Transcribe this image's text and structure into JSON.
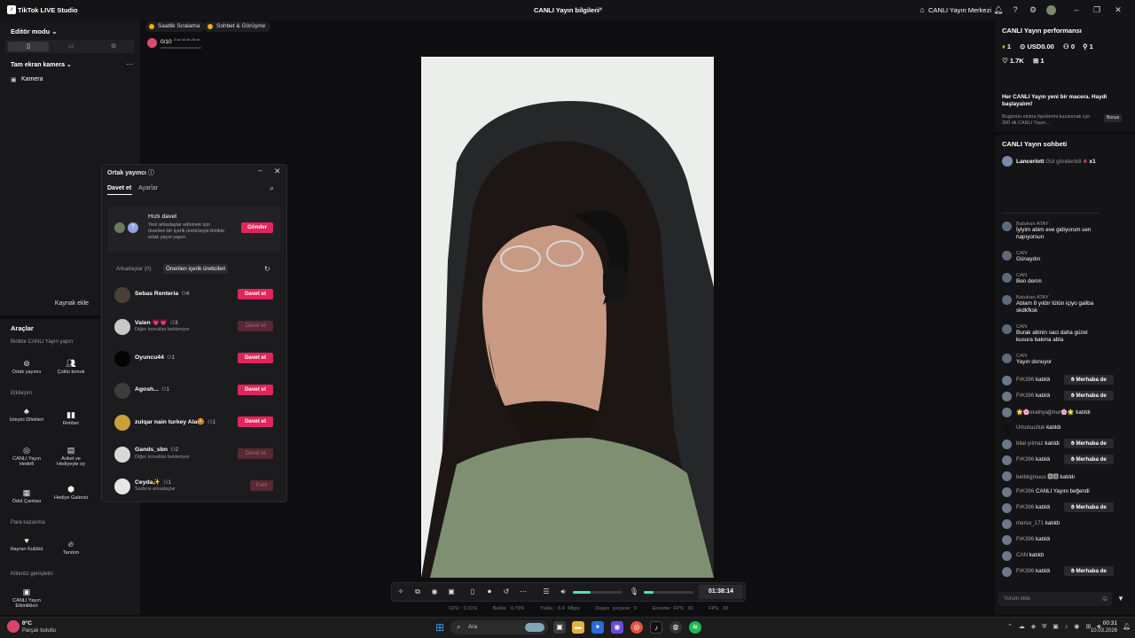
{
  "titlebar": {
    "app_title": "TikTok LIVE Studio",
    "live_info": "CANLI Yayın bilgileri",
    "live_center": "CANLI Yayın Merkezi"
  },
  "left": {
    "editor_mode": "Editör modu",
    "scene_name": "Tam ekran kamera",
    "camera_label": "Kamera",
    "add_source": "Kaynak ekle",
    "tools_title": "Araçlar",
    "sections": [
      "Birlikte CANLI Yayın yapın",
      "Etkileşim",
      "Para kazanma",
      "Kitlenizi genişletin"
    ],
    "tools": [
      {
        "label": "Ortak yayıncı",
        "icon": "cohost-icon"
      },
      {
        "label": "Çoklu konuk",
        "icon": "multi-guest-icon"
      },
      {
        "label": "İzleyici Dilekleri",
        "icon": "wishes-icon"
      },
      {
        "label": "Rehber",
        "icon": "guide-icon"
      },
      {
        "label": "CANLI Yayın Hedefi",
        "icon": "goal-icon"
      },
      {
        "label": "Anket ve Hediyeyle oy",
        "icon": "poll-icon"
      },
      {
        "label": "Ödül Çantası",
        "icon": "reward-bag-icon"
      },
      {
        "label": "Hediye Galerisi",
        "icon": "gift-gallery-icon"
      },
      {
        "label": "Hayran Kulübü",
        "icon": "fan-club-icon"
      },
      {
        "label": "Tanıtım",
        "icon": "promote-icon"
      },
      {
        "label": "CANLI Yayın Etkinlikleri",
        "icon": "events-icon"
      }
    ]
  },
  "pills": {
    "hourly": "Saatlik Sıralama",
    "chat_meet": "Sohbet & Görüşme",
    "goal": "0/10",
    "goal_timer": "3 sa 44 dk 26 sn"
  },
  "cohost": {
    "title": "Ortak yayıncı",
    "tab_invite": "Davet et",
    "tab_settings": "Ayarlar",
    "quick_title": "Hızlı davet",
    "quick_desc": "Yeni arkadaşlar edinmek için önerilen bir içerik üreticisiyle birlikte ortak yayın yapın",
    "send": "Gönder",
    "tab_friends": "Arkadaşlar (0)",
    "tab_suggested": "Önerilen içerik üreticileri",
    "rows": [
      {
        "name": "Sebas Renteria",
        "count": "4",
        "sub": "",
        "button": "Davet et",
        "enabled": true
      },
      {
        "name": "Valen 💗💗",
        "count": "3",
        "sub": "Diğer konuklar bekleniyor",
        "button": "Davet et",
        "enabled": false
      },
      {
        "name": "Oyuncu44",
        "count": "1",
        "sub": "",
        "button": "Davet et",
        "enabled": true
      },
      {
        "name": "Agosh...",
        "count": "1",
        "sub": "",
        "button": "Davet et",
        "enabled": true
      },
      {
        "name": "zulqar nain turkey Ala🤩",
        "count": "1",
        "sub": "",
        "button": "Davet et",
        "enabled": true
      },
      {
        "name": "Gands_sbn",
        "count": "2",
        "sub": "Diğer konuklar bekleniyor",
        "button": "Davet et",
        "enabled": false
      },
      {
        "name": "Ceyda✨",
        "count": "1",
        "sub": "Sadece arkadaşlar",
        "button": "Katıl",
        "enabled": false
      }
    ]
  },
  "controls": {
    "timer": "01:38:14",
    "volume_level": 0.35,
    "mic_level": 0.2
  },
  "stats": [
    "CPU: 0.31%",
    "Bellek: 0.79%",
    "Yükle.: 6.4 Mbps",
    "Düşen çerçeve: 0",
    "Encoder FPS: 30",
    "FPS: 30"
  ],
  "perf": {
    "title": "CANLI Yayın performansı",
    "items": [
      "1",
      "USD0.00",
      "0",
      "1",
      "1.7K",
      "1"
    ],
    "promo_title": "Her CANLI Yayın yeni bir macera. Haydi başlayalım!",
    "promo_desc": "Bugünün ekstra fişeklerini kazanmak için 300 dk CANLI Yayın...",
    "promo_badge": "Bonus"
  },
  "chat": {
    "title": "CANLI Yayın sohbeti",
    "pinned_user": "Lancerlott",
    "pinned_msg": "Gül gönderildi",
    "pinned_mult": "x1",
    "messages": [
      {
        "name": "Batuhan ATAY",
        "msg": "İyiyim abim eve gidiyorum sen napıyorsun"
      },
      {
        "name": "CAN",
        "msg": "Günaydın"
      },
      {
        "name": "CAN",
        "msg": "Ben derim"
      },
      {
        "name": "Batuhan ATAY",
        "msg": "Ablam 8 yıldır tütün içiyo galiba skdkfksk"
      },
      {
        "name": "CAN",
        "msg": "Burak abinin saci daha güzel kusura bakma abla"
      },
      {
        "name": "CAN",
        "msg": "Yayın donuyor"
      }
    ],
    "events": [
      {
        "name": "FrK396",
        "text": "katıldı",
        "hello": "Merhaba de"
      },
      {
        "name": "FrK396",
        "text": "katıldı",
        "hello": "Merhaba de"
      },
      {
        "name": "🌟🌸eraInyağmur🌸🌟",
        "text": "katıldı",
        "hello": ""
      },
      {
        "name": "Umutsuzluk",
        "text": "katıldı",
        "hello": ""
      },
      {
        "name": "bilal yılmaz",
        "text": "katıldı",
        "hello": "Merhaba de"
      },
      {
        "name": "FrK396",
        "text": "katıldı",
        "hello": "Merhaba de"
      },
      {
        "name": "berkkgmuus 🅰🅱",
        "text": "katıldı",
        "hello": ""
      },
      {
        "name": "FrK396",
        "text": "CANLI Yayını beğendi",
        "hello": ""
      },
      {
        "name": "FrK396",
        "text": "katıldı",
        "hello": "Merhaba de"
      },
      {
        "name": "merso_171",
        "text": "katıldı",
        "hello": ""
      },
      {
        "name": "FrK396",
        "text": "katıldı",
        "hello": ""
      },
      {
        "name": "CAN",
        "text": "katıldı",
        "hello": ""
      },
      {
        "name": "FrK396",
        "text": "katıldı",
        "hello": "Merhaba de"
      }
    ],
    "comment_placeholder": "Yorum ekle"
  },
  "taskbar": {
    "weather_temp": "0°C",
    "weather_desc": "Parçalı bulutlu",
    "search": "Ara",
    "time": "00:31",
    "date": "10.03.2026"
  },
  "colors": {
    "accent": "#e3245a",
    "bg": "#0e0e10",
    "panel": "#18181b"
  }
}
